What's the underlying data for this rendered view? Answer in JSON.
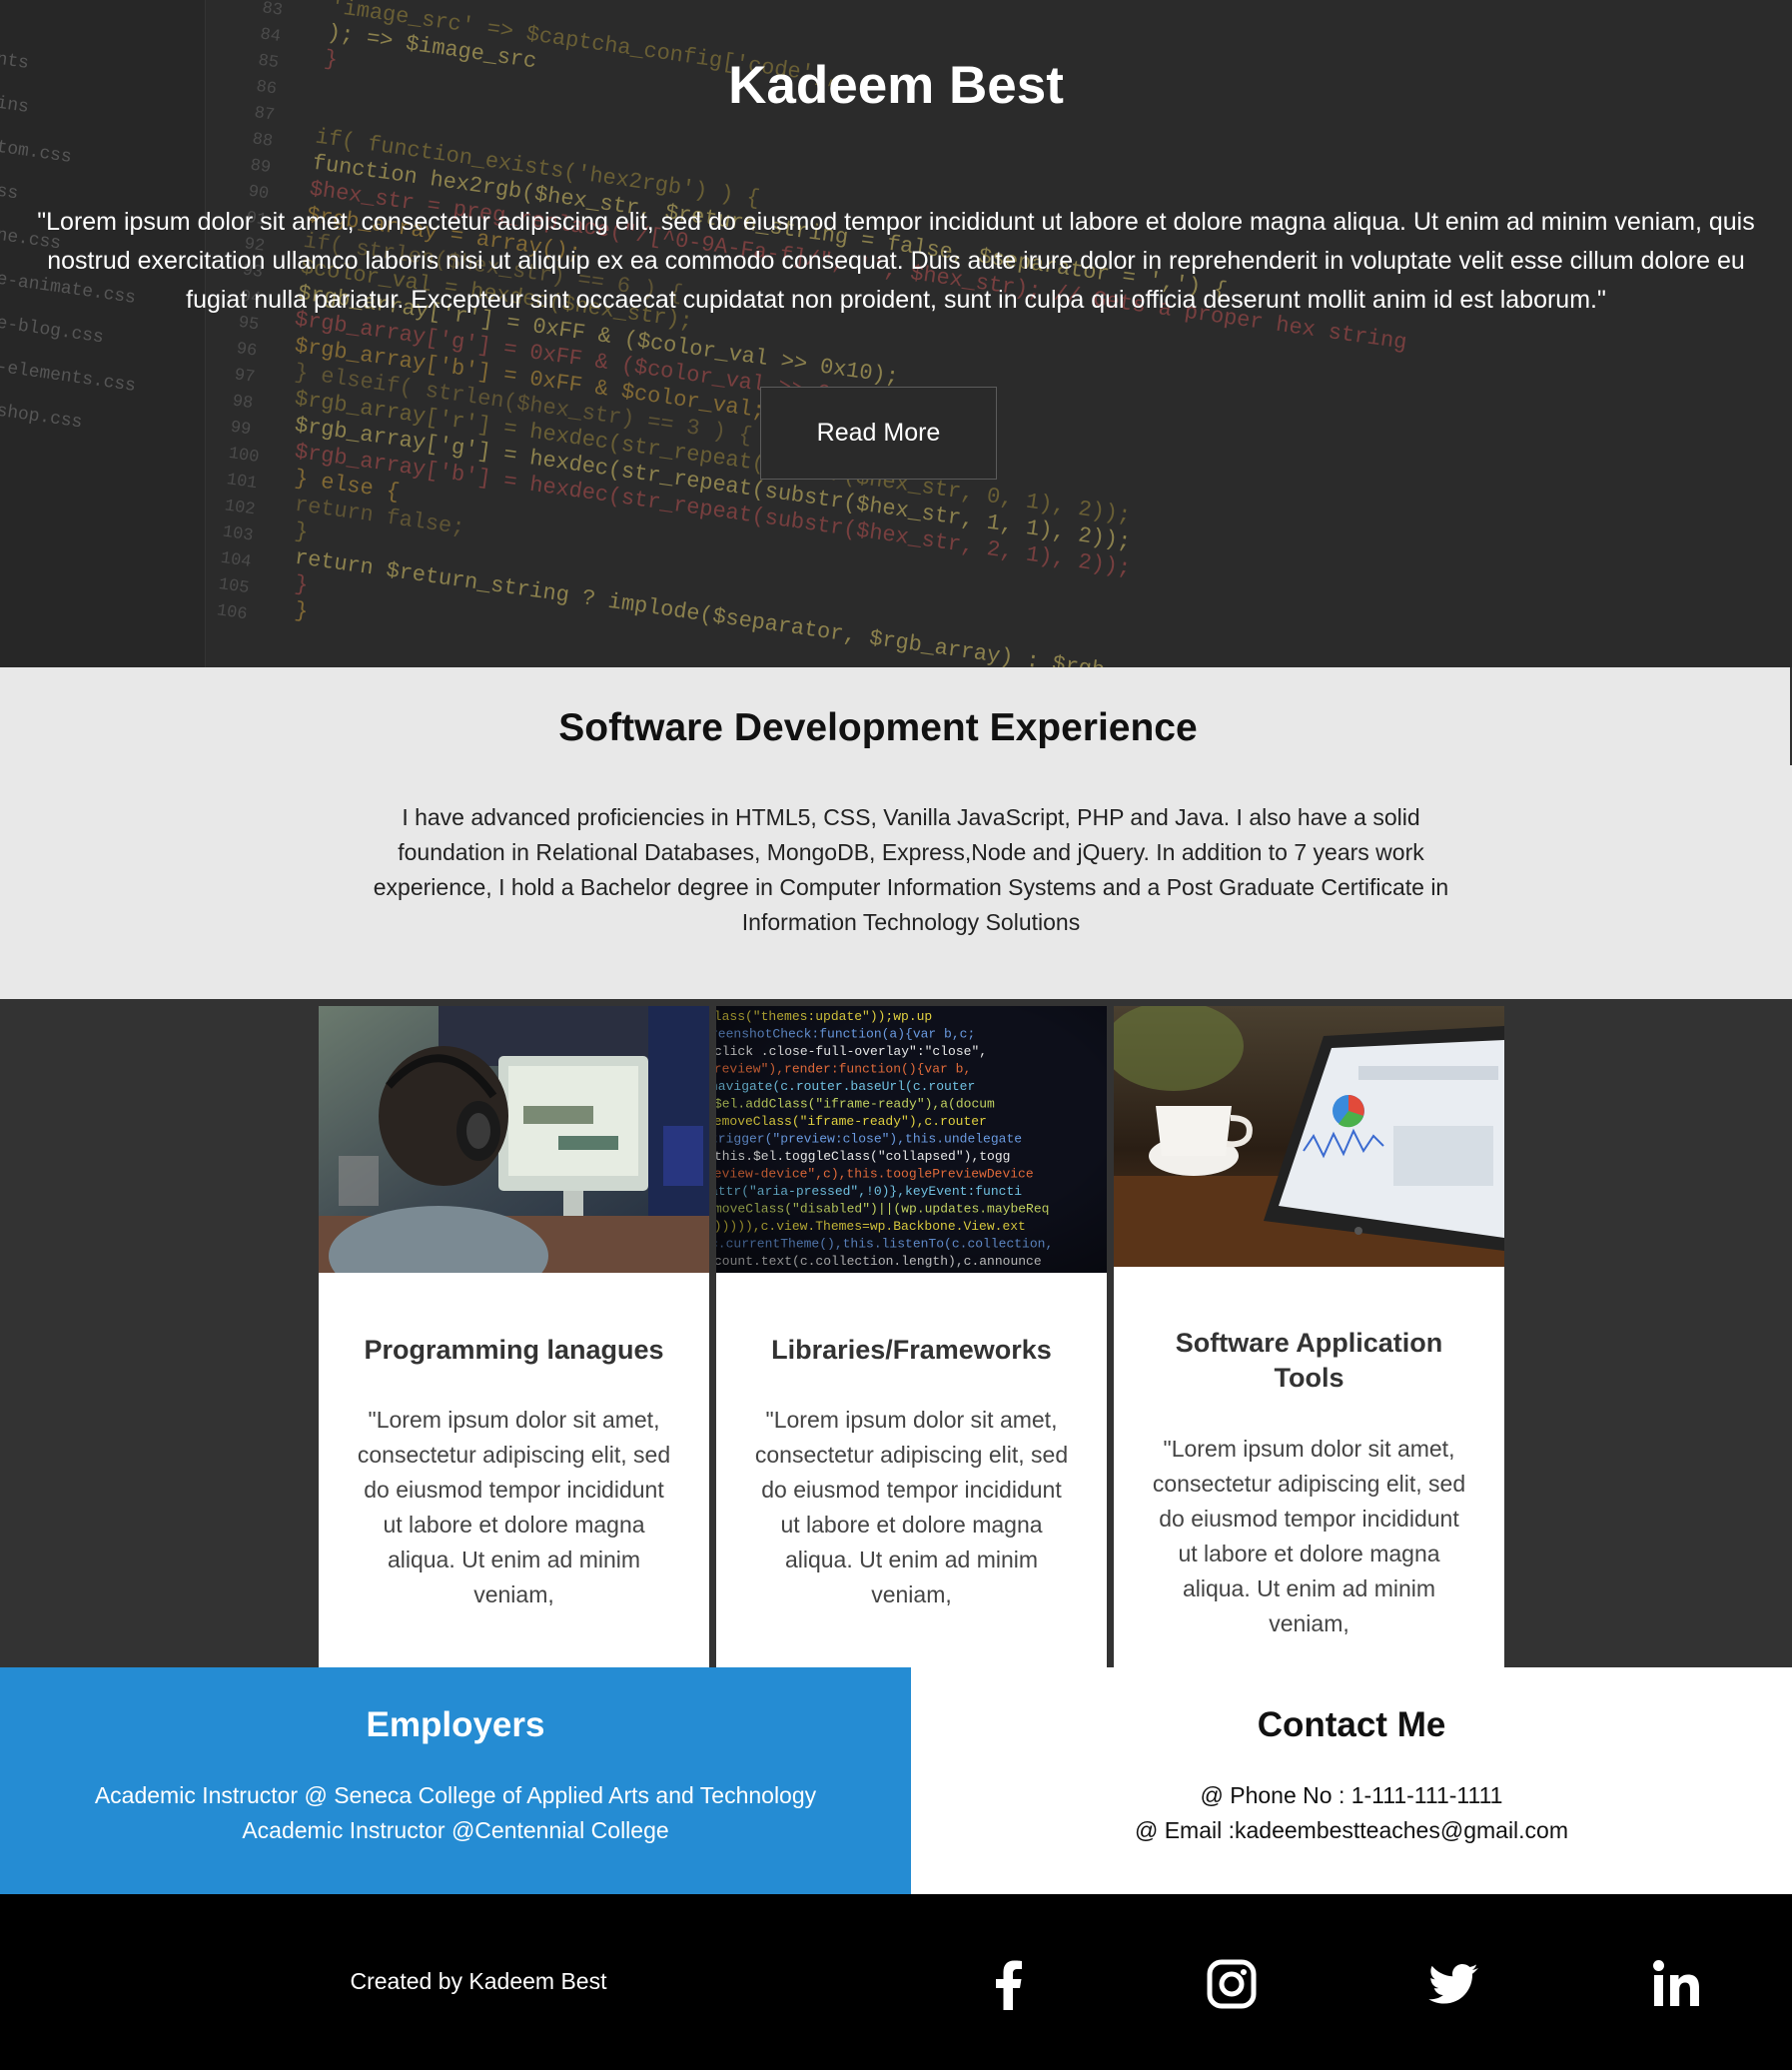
{
  "hero": {
    "title": "Kadeem Best",
    "quote": "\"Lorem ipsum dolor sit amet, consectetur adipiscing elit, sed do eiusmod tempor incididunt ut labore et dolore magna aliqua. Ut enim ad minim veniam, quis nostrud exercitation ullamco laboris nisi ut aliquip ex ea commodo consequat. Duis aute irure dolor in reprehenderit in voluptate velit esse cillum dolore eu fugiat nulla pariatur. Excepteur sint occaecat cupidatat non proident, sunt in culpa qui officia deserunt mollit anim id est laborum.\"",
    "button_label": "Read More",
    "background_code": {
      "line_numbers": [
        "83",
        "84",
        "85",
        "86",
        "87",
        "88",
        "89",
        "90",
        "91",
        "92",
        "93",
        "94",
        "95",
        "96",
        "97",
        "98",
        "99",
        "100",
        "101",
        "102",
        "103",
        "104",
        "105",
        "106"
      ],
      "sidebar_files": [
        "nts",
        "ins",
        "tom.css",
        "ss",
        "ne.css",
        "e-animate.css",
        "e-blog.css",
        "-elements.css",
        "shop.css"
      ],
      "lines": [
        "'image_src' => $captcha_config['code'],",
        ");    => $image_src",
        "}",
        "",
        "",
        "if( function_exists('hex2rgb') ) {",
        "function hex2rgb($hex_str, $return_string = false, $separator = ',') {",
        "$hex_str = preg_replace(\"/[^0-9A-Fa-f]/\", '', $hex_str); // Gets a proper hex string",
        "$rgb_array = array();",
        "if( strlen($hex_str) == 6 ) {",
        "$color_val = hexdec($hex_str);",
        "$rgb_array['r'] = 0xFF & ($color_val >> 0x10);",
        "$rgb_array['g'] = 0xFF & ($color_val >> 0x8);",
        "$rgb_array['b'] = 0xFF & $color_val;",
        "} elseif( strlen($hex_str) == 3 ) {",
        "$rgb_array['r'] = hexdec(str_repeat(substr($hex_str, 0, 1), 2));",
        "$rgb_array['g'] = hexdec(str_repeat(substr($hex_str, 1, 1), 2));",
        "$rgb_array['b'] = hexdec(str_repeat(substr($hex_str, 2, 1), 2));",
        "} else {",
        "return false;",
        "}",
        "return $return_string ? implode($separator, $rgb_array) : $rgb_array;",
        "}",
        "}"
      ]
    }
  },
  "experience": {
    "title": "Software Development Experience",
    "text": "I have advanced proficiencies in HTML5, CSS, Vanilla JavaScript, PHP and Java. I also have a solid foundation in Relational Databases, MongoDB, Express,Node and jQuery. In addition to 7 years work experience, I hold a Bachelor degree in Computer Information Systems and a Post Graduate Certificate in Information Technology Solutions"
  },
  "cards": [
    {
      "title": "Programming lanagues",
      "text": "\"Lorem ipsum dolor sit amet, consectetur adipiscing elit, sed do eiusmod tempor incididunt ut labore et dolore magna aliqua. Ut enim ad minim veniam,",
      "image": "person-with-headphones-at-computer"
    },
    {
      "title": "Libraries/Frameworks",
      "text": "\"Lorem ipsum dolor sit amet, consectetur adipiscing elit, sed do eiusmod tempor incididunt ut labore et dolore magna aliqua. Ut enim ad minim veniam,",
      "image": "colorful-source-code-screen",
      "code_lines": [
        "Class(\"themes:update\"));wp.up",
        "reenshotCheck:function(a){var b,c;",
        "click .close-full-overlay\":\"close\",",
        "preview\"),render:function(){var b,",
        "navigate(c.router.baseUrl(c.router",
        "$el.addClass(\"iframe-ready\"),a(docum",
        "removeClass(\"iframe-ready\"),c.router",
        "trigger(\"preview:close\"),this.undelegate",
        "this.$el.toggleClass(\"collapsed\"),togg",
        "review-device\",c),this.tooglePreviewDevice",
        "attr(\"aria-pressed\",!0)},keyEvent:functi",
        "moveClass(\"disabled\")||(wp.updates.maybeReq",
        "\"))))),c.view.Themes=wp.Backbone.View.ext",
        "c.currentTheme(),this.listenTo(c.collection,",
        "count.text(c.collection.length),c.announce"
      ]
    },
    {
      "title": "Software Application Tools",
      "text": "\"Lorem ipsum dolor sit amet, consectetur adipiscing elit, sed do eiusmod tempor incididunt ut labore et dolore magna aliqua. Ut enim ad minim veniam,",
      "image": "tablet-with-dashboard-and-coffee-cup"
    }
  ],
  "employers": {
    "title": "Employers",
    "lines": [
      "Academic Instructor @ Seneca College of Applied Arts and Technology",
      "Academic Instructor @Centennial College"
    ]
  },
  "contact": {
    "title": "Contact Me",
    "phone": "@ Phone No : 1-111-111-1111",
    "email": "@ Email :kadeembestteaches@gmail.com"
  },
  "footer": {
    "credit": "Created by Kadeem Best",
    "social_icons": [
      "facebook-icon",
      "instagram-icon",
      "twitter-icon",
      "linkedin-icon"
    ]
  },
  "colors": {
    "hero_bg": "#2c2c2c",
    "experience_bg": "#e8e8e8",
    "cards_band_bg": "#333333",
    "employers_bg": "#258cd3",
    "footer_bg": "#000000"
  }
}
